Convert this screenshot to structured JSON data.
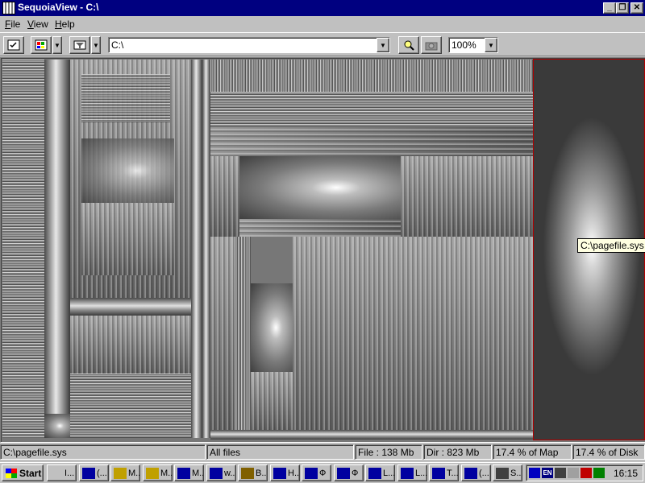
{
  "window": {
    "title": "SequoiaView - C:\\"
  },
  "menu": {
    "items": [
      "File",
      "View",
      "Help"
    ]
  },
  "toolbar": {
    "path": "C:\\",
    "zoom": "100%"
  },
  "treemap": {
    "tooltip": "C:\\pagefile.sys"
  },
  "status": {
    "path": "C:\\pagefile.sys",
    "filter": "All files",
    "file_size": "File : 138 Mb",
    "dir_size": "Dir : 823 Mb",
    "map_pct": "17.4 % of Map",
    "disk_pct": "17.4 % of Disk"
  },
  "taskbar": {
    "start": "Start",
    "tasks": [
      "I...",
      "(...",
      "M...",
      "M...",
      "M...",
      "w...",
      "B...",
      "H...",
      "Ф",
      "Ф",
      "L...",
      "L...",
      "T...",
      "(...",
      "S..."
    ],
    "tray_lang": "EN",
    "clock": "16:15"
  },
  "colors": {
    "title_bar": "#000080",
    "selection_border": "#b00000",
    "tooltip_bg": "#ffffe1",
    "chrome": "#c0c0c0"
  }
}
